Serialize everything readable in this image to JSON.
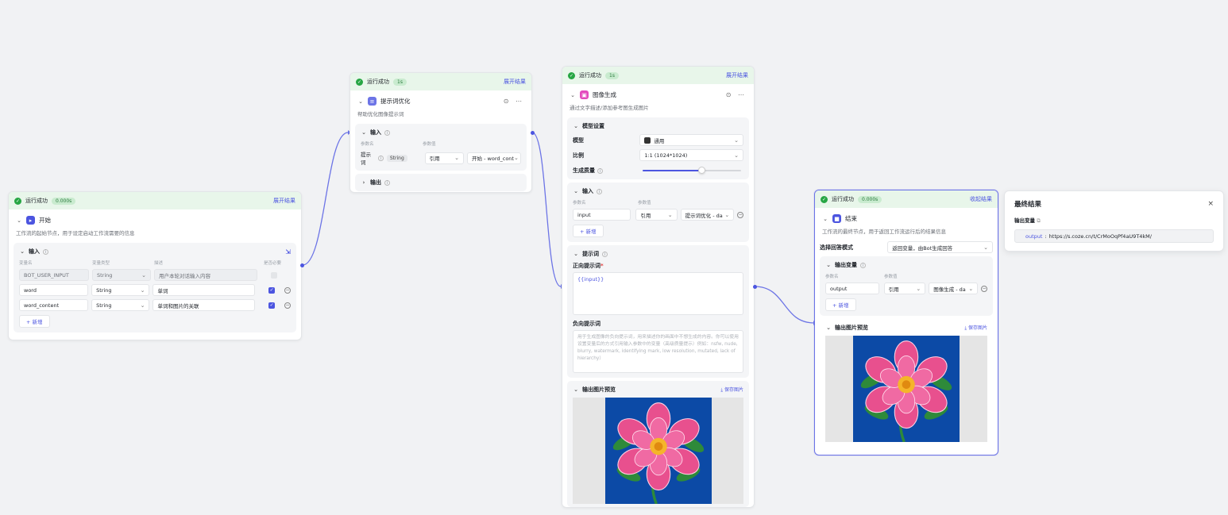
{
  "status": {
    "success_label": "运行成功",
    "expand_result": "展开结果",
    "collapse_result": "收起结果"
  },
  "start_node": {
    "time": "0.000s",
    "title": "开始",
    "description": "工作流的起始节点，用于设定启动工作流需要的信息",
    "input_title": "输入",
    "col_headers": [
      "变量名",
      "变量类型",
      "描述",
      "是否必要"
    ],
    "rows": [
      {
        "name": "BOT_USER_INPUT",
        "type": "String",
        "desc": "用户本轮对话输入内容",
        "required": false
      },
      {
        "name": "word",
        "type": "String",
        "desc": "单词",
        "required": true
      },
      {
        "name": "word_content",
        "type": "String",
        "desc": "单词和图片的关联",
        "required": true
      }
    ],
    "add_label": "+ 新增"
  },
  "prompt_node": {
    "time": "1s",
    "title": "提示词优化",
    "description": "帮助优化图像提示词",
    "input_title": "输入",
    "col_headers": [
      "参数名",
      "参数值"
    ],
    "param_name": "提示词",
    "param_type": "String",
    "ref_label": "引用",
    "ref_value": "开始 - word_cont",
    "output_title": "输出"
  },
  "image_node": {
    "time": "1s",
    "title": "图像生成",
    "description": "通过文字描述/添加参考图生成图片",
    "model_section": "模型设置",
    "model_label": "模型",
    "model_value": "通用",
    "ratio_label": "比例",
    "ratio_value": "1:1 (1024*1024)",
    "quality_label": "生成质量",
    "quality_value": 0.6,
    "input_title": "输入",
    "col_headers": [
      "参数名",
      "参数值"
    ],
    "input_name": "input",
    "ref_label": "引用",
    "ref_value": "提示词优化 - da",
    "add_label": "+ 新增",
    "prompt_section": "提示词",
    "positive_label": "正向提示词",
    "positive_value": "{{input}}",
    "negative_label": "负向提示词",
    "negative_placeholder": "用于生成图像的负向提示词，用来描述你的画面中不想生成的内容。你可以使用设置变量后的方式引用输入参数中的变量（高级质量提示）例如：nsfw, nude, blurry, watermark, identifying mark, low resolution, mutated, lack of hierarchy）",
    "preview_title": "输出图片预览",
    "save_label": "保存图片"
  },
  "end_node": {
    "time": "0.000s",
    "title": "结束",
    "description": "工作流的最终节点，用于返回工作流运行后的结果信息",
    "mode_label": "选择回答模式",
    "mode_value": "返回变量，由Bot生成回答",
    "output_title": "输出变量",
    "col_headers": [
      "参数名",
      "参数值"
    ],
    "output_name": "output",
    "ref_label": "引用",
    "ref_value": "图像生成 - da",
    "add_label": "+ 新增",
    "preview_title": "输出图片预览",
    "save_label": "保存图片"
  },
  "result_panel": {
    "title": "最终结果",
    "var_label": "输出变量",
    "value_key": "output",
    "value_url": "https://s.coze.cn/t/CrMoOqPf4aU9T4kM/"
  },
  "colors": {
    "accent": "#4c55e0",
    "success": "#27a644",
    "success_bg": "#e8f6ea",
    "canvas": "#f1f2f4"
  }
}
